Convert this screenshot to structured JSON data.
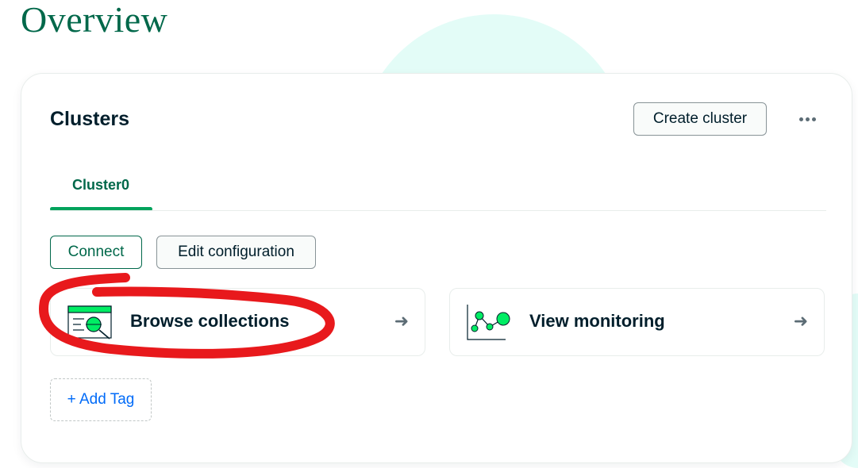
{
  "page": {
    "title": "Overview"
  },
  "card": {
    "title": "Clusters",
    "create_label": "Create cluster",
    "more_icon": "ellipsis-icon"
  },
  "tabs": [
    {
      "label": "Cluster0",
      "active": true
    }
  ],
  "actions": {
    "connect_label": "Connect",
    "edit_label": "Edit configuration"
  },
  "quick_links": [
    {
      "label": "Browse collections",
      "icon": "browse-collections-icon",
      "arrow": "➜"
    },
    {
      "label": "View monitoring",
      "icon": "monitoring-chart-icon",
      "arrow": "➜"
    }
  ],
  "tag": {
    "label": "+ Add Tag"
  },
  "annotation": {
    "shape": "hand-drawn-ellipse",
    "color": "#e8191c",
    "target": "Browse collections"
  },
  "colors": {
    "brand_green": "#00684a",
    "accent_green": "#00a35c",
    "icon_green": "#00ed64",
    "link_blue": "#016bf8",
    "background_blob": "#e3fcf7"
  }
}
